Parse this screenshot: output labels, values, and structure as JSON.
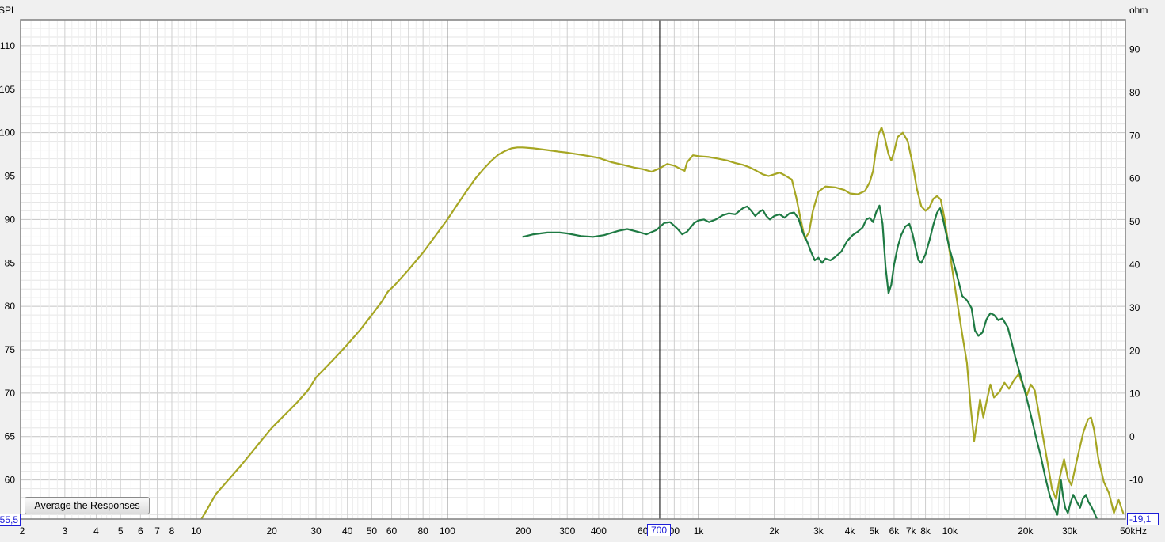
{
  "chart_data": {
    "type": "line",
    "xlabel": "",
    "x_unit": "Hz",
    "x_scale": "log",
    "xlim": [
      2,
      50000
    ],
    "left_axis": {
      "label": "SPL",
      "ylim": [
        55.5,
        113
      ],
      "ticks": [
        60,
        65,
        70,
        75,
        80,
        85,
        90,
        95,
        100,
        105,
        110
      ]
    },
    "right_axis": {
      "label": "ohm",
      "ylim": [
        -19.1,
        96.9
      ],
      "ticks": [
        -10,
        0,
        10,
        20,
        30,
        40,
        50,
        60,
        70,
        80,
        90
      ]
    },
    "x_ticks": [
      {
        "value": 2,
        "label": "2"
      },
      {
        "value": 3,
        "label": "3"
      },
      {
        "value": 4,
        "label": "4"
      },
      {
        "value": 5,
        "label": "5"
      },
      {
        "value": 6,
        "label": "6"
      },
      {
        "value": 7,
        "label": "7"
      },
      {
        "value": 8,
        "label": "8"
      },
      {
        "value": 10,
        "label": "10"
      },
      {
        "value": 20,
        "label": "20"
      },
      {
        "value": 30,
        "label": "30"
      },
      {
        "value": 40,
        "label": "40"
      },
      {
        "value": 50,
        "label": "50"
      },
      {
        "value": 60,
        "label": "60"
      },
      {
        "value": 80,
        "label": "80"
      },
      {
        "value": 100,
        "label": "100"
      },
      {
        "value": 200,
        "label": "200"
      },
      {
        "value": 300,
        "label": "300"
      },
      {
        "value": 400,
        "label": "400"
      },
      {
        "value": 600,
        "label": "60"
      },
      {
        "value": 800,
        "label": "00"
      },
      {
        "value": 1000,
        "label": "1k"
      },
      {
        "value": 2000,
        "label": "2k"
      },
      {
        "value": 3000,
        "label": "3k"
      },
      {
        "value": 4000,
        "label": "4k"
      },
      {
        "value": 5000,
        "label": "5k"
      },
      {
        "value": 6000,
        "label": "6k"
      },
      {
        "value": 7000,
        "label": "7k"
      },
      {
        "value": 8000,
        "label": "8k"
      },
      {
        "value": 10000,
        "label": "10k"
      },
      {
        "value": 20000,
        "label": "20k"
      },
      {
        "value": 30000,
        "label": "30k"
      },
      {
        "value": 50000,
        "label": "50kHz"
      }
    ],
    "cursor": {
      "x": 700,
      "label": "700"
    },
    "readouts": {
      "left": "55,5",
      "right": "-19,1"
    },
    "grid": true,
    "series": [
      {
        "color": "#a6a623",
        "points": [
          [
            10.5,
            55.5
          ],
          [
            12,
            58.4
          ],
          [
            15,
            61.6
          ],
          [
            17,
            63.5
          ],
          [
            18,
            64.4
          ],
          [
            20,
            66.0
          ],
          [
            22,
            67.2
          ],
          [
            25,
            68.8
          ],
          [
            28,
            70.4
          ],
          [
            30,
            71.8
          ],
          [
            35,
            73.8
          ],
          [
            40,
            75.6
          ],
          [
            45,
            77.3
          ],
          [
            50,
            79.0
          ],
          [
            55,
            80.6
          ],
          [
            58,
            81.7
          ],
          [
            62,
            82.5
          ],
          [
            70,
            84.2
          ],
          [
            80,
            86.2
          ],
          [
            90,
            88.2
          ],
          [
            100,
            90.0
          ],
          [
            110,
            91.8
          ],
          [
            120,
            93.4
          ],
          [
            130,
            94.8
          ],
          [
            140,
            95.9
          ],
          [
            150,
            96.8
          ],
          [
            160,
            97.5
          ],
          [
            170,
            97.9
          ],
          [
            180,
            98.2
          ],
          [
            190,
            98.3
          ],
          [
            200,
            98.3
          ],
          [
            220,
            98.2
          ],
          [
            250,
            98.0
          ],
          [
            280,
            97.8
          ],
          [
            300,
            97.7
          ],
          [
            350,
            97.4
          ],
          [
            400,
            97.1
          ],
          [
            450,
            96.6
          ],
          [
            500,
            96.3
          ],
          [
            550,
            96.0
          ],
          [
            600,
            95.8
          ],
          [
            650,
            95.5
          ],
          [
            700,
            95.9
          ],
          [
            750,
            96.4
          ],
          [
            800,
            96.2
          ],
          [
            850,
            95.8
          ],
          [
            880,
            95.6
          ],
          [
            900,
            96.6
          ],
          [
            950,
            97.4
          ],
          [
            1000,
            97.3
          ],
          [
            1100,
            97.2
          ],
          [
            1200,
            97.0
          ],
          [
            1300,
            96.8
          ],
          [
            1400,
            96.5
          ],
          [
            1500,
            96.3
          ],
          [
            1600,
            96.0
          ],
          [
            1700,
            95.6
          ],
          [
            1800,
            95.2
          ],
          [
            1900,
            95.0
          ],
          [
            2000,
            95.2
          ],
          [
            2100,
            95.4
          ],
          [
            2200,
            95.1
          ],
          [
            2350,
            94.6
          ],
          [
            2450,
            92.5
          ],
          [
            2550,
            90.0
          ],
          [
            2650,
            87.8
          ],
          [
            2750,
            88.5
          ],
          [
            2850,
            91.0
          ],
          [
            3000,
            93.2
          ],
          [
            3200,
            93.8
          ],
          [
            3500,
            93.7
          ],
          [
            3800,
            93.4
          ],
          [
            4000,
            93.0
          ],
          [
            4300,
            92.9
          ],
          [
            4600,
            93.3
          ],
          [
            4800,
            94.3
          ],
          [
            4950,
            95.6
          ],
          [
            5050,
            97.5
          ],
          [
            5200,
            99.8
          ],
          [
            5350,
            100.6
          ],
          [
            5500,
            99.5
          ],
          [
            5700,
            97.5
          ],
          [
            5850,
            96.8
          ],
          [
            6000,
            97.8
          ],
          [
            6200,
            99.5
          ],
          [
            6500,
            100.0
          ],
          [
            6800,
            99.0
          ],
          [
            7100,
            96.5
          ],
          [
            7400,
            93.5
          ],
          [
            7700,
            91.5
          ],
          [
            8000,
            91.0
          ],
          [
            8300,
            91.4
          ],
          [
            8600,
            92.4
          ],
          [
            8900,
            92.7
          ],
          [
            9200,
            92.3
          ],
          [
            9500,
            90.3
          ],
          [
            9800,
            87.8
          ],
          [
            10200,
            84.5
          ],
          [
            10700,
            80.5
          ],
          [
            11200,
            76.8
          ],
          [
            11700,
            73.5
          ],
          [
            12100,
            68.5
          ],
          [
            12500,
            64.5
          ],
          [
            12800,
            66.5
          ],
          [
            13200,
            69.3
          ],
          [
            13600,
            67.2
          ],
          [
            14000,
            69.0
          ],
          [
            14500,
            71.0
          ],
          [
            15000,
            69.5
          ],
          [
            15800,
            70.2
          ],
          [
            16500,
            71.2
          ],
          [
            17200,
            70.5
          ],
          [
            18000,
            71.5
          ],
          [
            18800,
            72.2
          ],
          [
            19500,
            71.0
          ],
          [
            20300,
            69.8
          ],
          [
            21000,
            71.0
          ],
          [
            21800,
            70.3
          ],
          [
            23000,
            66.5
          ],
          [
            24500,
            62.0
          ],
          [
            25500,
            59.0
          ],
          [
            26500,
            57.8
          ],
          [
            27500,
            60.5
          ],
          [
            28500,
            62.4
          ],
          [
            29500,
            60.2
          ],
          [
            30500,
            59.4
          ],
          [
            32000,
            62.2
          ],
          [
            34000,
            65.5
          ],
          [
            35500,
            67.0
          ],
          [
            36500,
            67.2
          ],
          [
            37500,
            65.8
          ],
          [
            39000,
            62.5
          ],
          [
            41000,
            59.8
          ],
          [
            43000,
            58.5
          ],
          [
            45000,
            56.2
          ],
          [
            47000,
            57.7
          ],
          [
            49000,
            56.2
          ]
        ]
      },
      {
        "color": "#1e7a43",
        "points": [
          [
            200,
            88.0
          ],
          [
            220,
            88.3
          ],
          [
            250,
            88.5
          ],
          [
            280,
            88.5
          ],
          [
            300,
            88.4
          ],
          [
            340,
            88.1
          ],
          [
            380,
            88.0
          ],
          [
            420,
            88.2
          ],
          [
            480,
            88.7
          ],
          [
            520,
            88.9
          ],
          [
            570,
            88.6
          ],
          [
            620,
            88.3
          ],
          [
            680,
            88.8
          ],
          [
            730,
            89.6
          ],
          [
            770,
            89.7
          ],
          [
            820,
            89.0
          ],
          [
            860,
            88.3
          ],
          [
            900,
            88.6
          ],
          [
            960,
            89.6
          ],
          [
            1000,
            89.9
          ],
          [
            1050,
            90.0
          ],
          [
            1100,
            89.7
          ],
          [
            1170,
            90.0
          ],
          [
            1250,
            90.5
          ],
          [
            1320,
            90.7
          ],
          [
            1400,
            90.6
          ],
          [
            1500,
            91.3
          ],
          [
            1560,
            91.5
          ],
          [
            1620,
            91.0
          ],
          [
            1680,
            90.4
          ],
          [
            1750,
            90.9
          ],
          [
            1800,
            91.1
          ],
          [
            1860,
            90.4
          ],
          [
            1920,
            90.0
          ],
          [
            2000,
            90.4
          ],
          [
            2100,
            90.6
          ],
          [
            2200,
            90.2
          ],
          [
            2300,
            90.7
          ],
          [
            2400,
            90.8
          ],
          [
            2500,
            90.1
          ],
          [
            2600,
            88.5
          ],
          [
            2700,
            87.5
          ],
          [
            2800,
            86.3
          ],
          [
            2900,
            85.3
          ],
          [
            3000,
            85.6
          ],
          [
            3100,
            85.0
          ],
          [
            3200,
            85.5
          ],
          [
            3350,
            85.3
          ],
          [
            3500,
            85.7
          ],
          [
            3700,
            86.3
          ],
          [
            3900,
            87.5
          ],
          [
            4100,
            88.2
          ],
          [
            4300,
            88.6
          ],
          [
            4500,
            89.1
          ],
          [
            4650,
            90.0
          ],
          [
            4800,
            90.2
          ],
          [
            4950,
            89.7
          ],
          [
            5100,
            90.9
          ],
          [
            5250,
            91.6
          ],
          [
            5400,
            89.5
          ],
          [
            5550,
            84.5
          ],
          [
            5700,
            81.5
          ],
          [
            5850,
            82.5
          ],
          [
            6000,
            84.8
          ],
          [
            6200,
            86.8
          ],
          [
            6400,
            88.2
          ],
          [
            6650,
            89.2
          ],
          [
            6900,
            89.5
          ],
          [
            7100,
            88.4
          ],
          [
            7300,
            86.8
          ],
          [
            7500,
            85.3
          ],
          [
            7700,
            85.0
          ],
          [
            8000,
            86.0
          ],
          [
            8300,
            87.6
          ],
          [
            8600,
            89.4
          ],
          [
            8900,
            90.8
          ],
          [
            9150,
            91.3
          ],
          [
            9400,
            90.0
          ],
          [
            9700,
            88.2
          ],
          [
            10000,
            86.5
          ],
          [
            10400,
            84.8
          ],
          [
            10800,
            83.0
          ],
          [
            11200,
            81.2
          ],
          [
            11700,
            80.7
          ],
          [
            12200,
            79.8
          ],
          [
            12600,
            77.2
          ],
          [
            13000,
            76.6
          ],
          [
            13500,
            77.0
          ],
          [
            14000,
            78.5
          ],
          [
            14500,
            79.2
          ],
          [
            15000,
            79.0
          ],
          [
            15600,
            78.4
          ],
          [
            16200,
            78.6
          ],
          [
            17000,
            77.6
          ],
          [
            17500,
            76.2
          ],
          [
            18200,
            74.2
          ],
          [
            19000,
            72.3
          ],
          [
            20000,
            70.0
          ],
          [
            21000,
            67.5
          ],
          [
            22000,
            65.0
          ],
          [
            23000,
            62.8
          ],
          [
            24000,
            60.3
          ],
          [
            25000,
            58.2
          ],
          [
            26000,
            56.8
          ],
          [
            26800,
            56.0
          ],
          [
            27200,
            57.5
          ],
          [
            27700,
            60.0
          ],
          [
            28200,
            58.2
          ],
          [
            28800,
            56.8
          ],
          [
            29500,
            56.2
          ],
          [
            30200,
            57.3
          ],
          [
            31000,
            58.3
          ],
          [
            32000,
            57.5
          ],
          [
            33000,
            56.8
          ],
          [
            33800,
            57.8
          ],
          [
            34800,
            58.3
          ],
          [
            35600,
            57.5
          ],
          [
            36500,
            57.0
          ],
          [
            37500,
            56.3
          ],
          [
            38500,
            55.5
          ]
        ]
      }
    ]
  },
  "button": {
    "label": "Average the Responses"
  }
}
